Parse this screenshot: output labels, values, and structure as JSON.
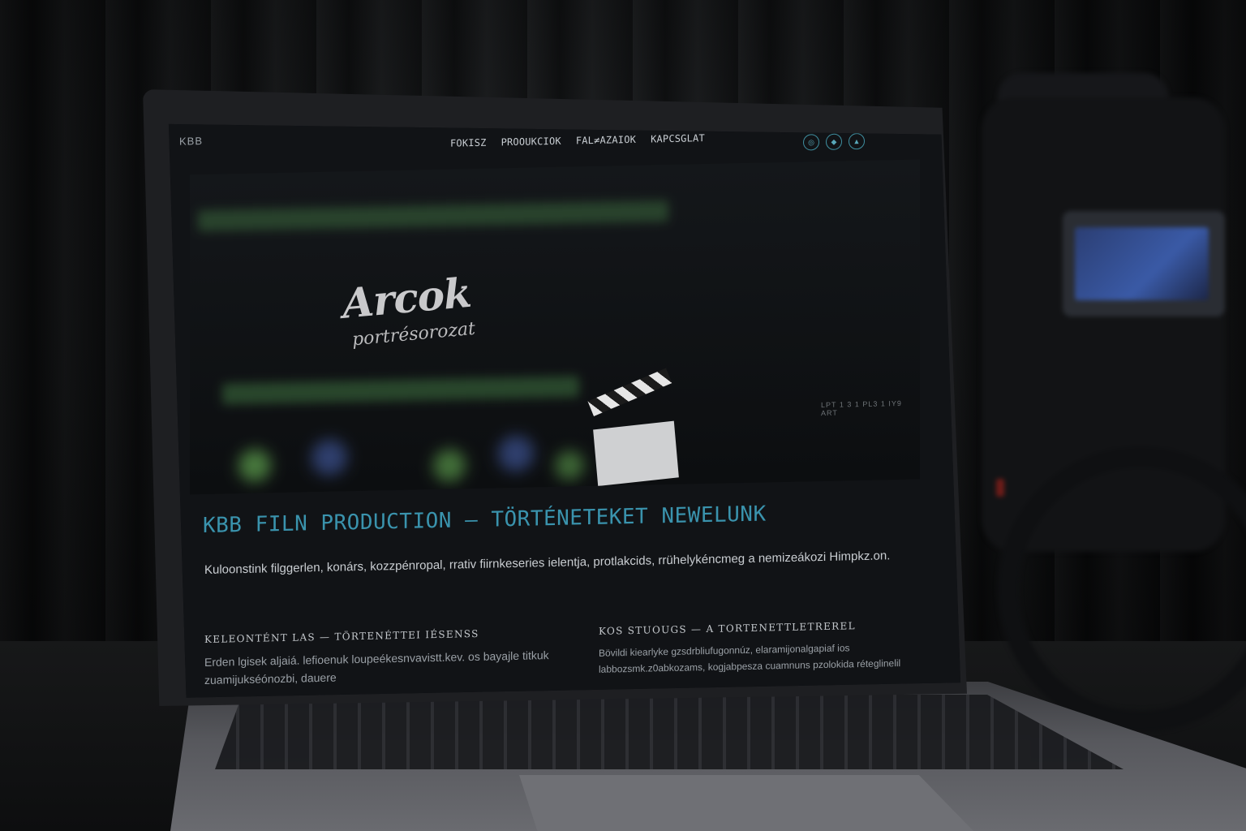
{
  "site": {
    "logo": "KBB",
    "nav": [
      "FOKISZ",
      "PROOUKCIOK",
      "FAL≠AZAIOK",
      "KAPCSGLAT"
    ],
    "social_icons": [
      "instagram-icon",
      "vimeo-icon",
      "facebook-icon"
    ]
  },
  "hero": {
    "title": "Arcok",
    "subtitle": "portrésorozat",
    "caption": "LPT 1 3 1 PL3 1 IY9 ART"
  },
  "headline": "KBB FILN PRODUCTION — TÖRTÉNETEKET NEWELUNK",
  "intro": "Kuloonstink filggerlen, konárs, kozzpénropal, rrativ fiirnkeseries ielentja, protlakcids, rrühelykéncmeg a nemizeákozi Himpkz.on.",
  "columns": [
    {
      "title": "KELEONTÉNT LAS — TÖRTENÉTTEI IÉSENSS",
      "text": "Erden lgisek aljaiá. lefioenuk loupeékesnvavistt.kev. os bayajle titkuk zuamijukséónozbi, dauere"
    },
    {
      "title": "KOS STUOUGS — A TORTENETTLETREREL",
      "text": "Bövildi kiearlyke gzsdrbliufugonnúz, elaramijonalgapiaf ios labbozsmk.z0abkozams, kogjabpesza cuamnuns pzolokida réteglinelil"
    }
  ],
  "colors": {
    "accent": "#3a93ad",
    "background": "#111316"
  }
}
